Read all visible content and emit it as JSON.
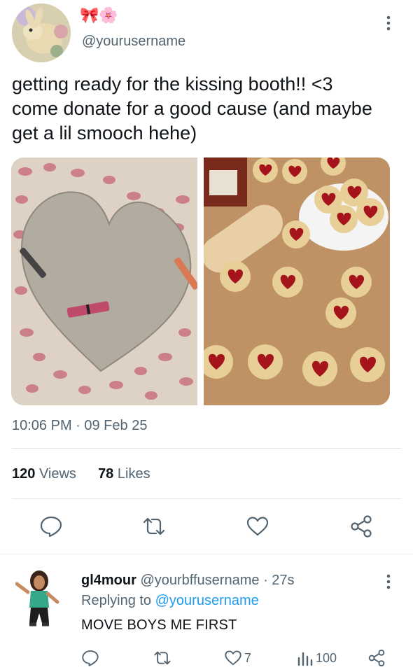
{
  "tweet": {
    "display_name": "🎀🌸",
    "handle": "@yourusername",
    "text_lines": [
      "getting ready for the kissing booth!! <3",
      "come donate for a good cause (and maybe",
      "get a lil smooch hehe)"
    ],
    "timestamp": "10:06 PM · 09 Feb 25",
    "views_count": "120",
    "views_label": "Views",
    "likes_count": "78",
    "likes_label": "Likes",
    "media": [
      {
        "kind": "photo",
        "icon": "lipstick-heart-poster"
      },
      {
        "kind": "photo",
        "icon": "heart-jam-cookies"
      }
    ],
    "actions": [
      "reply-icon",
      "retweet-icon",
      "like-icon",
      "share-icon"
    ]
  },
  "reply": {
    "name": "gl4mour",
    "handle": "@yourbffusername",
    "time": "· 27s",
    "replying_prefix": "Replying to",
    "replying_handle": "@yourusername",
    "text": "MOVE BOYS ME FIRST",
    "like_count": "7",
    "views_count": "100"
  },
  "colors": {
    "accent": "#1d9bf0",
    "text": "#0f1419",
    "muted": "#536471",
    "divider": "#e1e6ea"
  }
}
